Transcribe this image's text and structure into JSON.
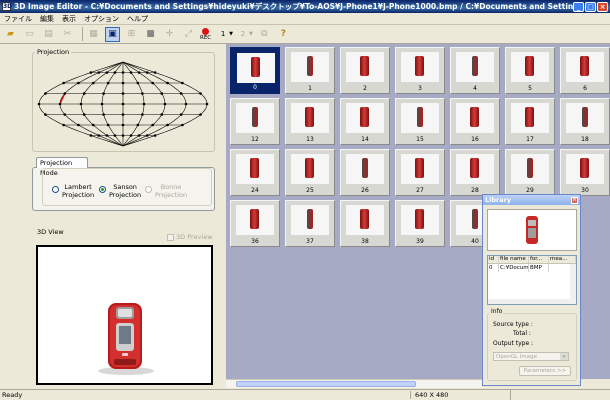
{
  "window": {
    "app_icon": "3D",
    "title": "3D Image Editor - C:¥Documents and Settings¥hideyuki¥デスクトップ¥To-AOS¥J-Phone1¥J-Phone1000.bmp / C:¥Documents and Settings¥hi"
  },
  "menu": [
    "ファイル",
    "編集",
    "表示",
    "オプション",
    "ヘルプ"
  ],
  "toolbar": {
    "rec_label": "REC",
    "frame_value": "1",
    "frame_value2": "2",
    "help_glyph": "?"
  },
  "left": {
    "projection_label": "Projection",
    "projection_mode_tab": "Projection Mode",
    "radios": [
      {
        "label": "Lambert\nProjection",
        "checked": false,
        "enabled": true
      },
      {
        "label": "Sanson\nProjection",
        "checked": true,
        "enabled": true
      },
      {
        "label": "Bonne\nProjection",
        "checked": false,
        "enabled": false
      }
    ],
    "view_label": "3D View",
    "preview_checkbox": "3D Preview"
  },
  "thumbnails": [
    "0",
    "1",
    "2",
    "3",
    "4",
    "5",
    "6",
    "12",
    "13",
    "14",
    "15",
    "16",
    "17",
    "18",
    "24",
    "25",
    "26",
    "27",
    "28",
    "29",
    "30",
    "36",
    "37",
    "38",
    "39",
    "40"
  ],
  "selected_thumbnail": "0",
  "library": {
    "title": "Library",
    "columns": [
      "id",
      "file name",
      "for...",
      "mea..."
    ],
    "rows": [
      [
        "0",
        "C:¥Docum...",
        "BMP",
        ""
      ]
    ],
    "info_label": "Info",
    "source_type": "Source type :",
    "total": "Total :",
    "output_type": "Output type :",
    "output_value": "OpenGL Image",
    "parameters_button": "Parameters >>"
  },
  "status": {
    "message": "Ready",
    "resolution": "640 X 480"
  },
  "colors": {
    "titlebar": "#0a246a",
    "grid_bg": "#a6aac4",
    "phone_red": "#c62828",
    "selection": "#0a246a"
  }
}
